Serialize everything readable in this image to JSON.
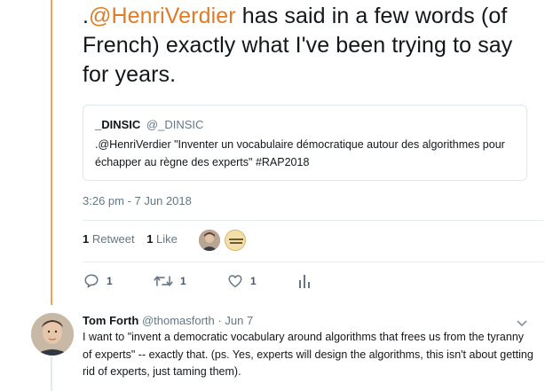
{
  "tweet": {
    "text_prefix": ".",
    "mention": "@HenriVerdier",
    "text_rest": " has said in a few words (of French) exactly what I've been trying to say for years.",
    "timestamp": "3:26 pm - 7 Jun 2018"
  },
  "quote": {
    "name": "_DINSIC",
    "handle": "@_DINSIC",
    "body": ".@HenriVerdier \"Inventer un vocabulaire démocratique autour des algorithmes pour échapper au règne des experts\" #RAP2018"
  },
  "stats": {
    "retweet_count": "1",
    "retweet_label": "Retweet",
    "like_count": "1",
    "like_label": "Like"
  },
  "actions": {
    "reply_count": "1",
    "retweet_count": "1",
    "like_count": "1"
  },
  "reply": {
    "name": "Tom Forth",
    "handle": "@thomasforth",
    "separator": "·",
    "date": "Jun 7",
    "text": "I want to \"invent a democratic vocabulary around algorithms that frees us from the tyranny of experts\" -- exactly that. (ps. Yes, experts will design the algorithms, this isn't about getting rid of experts, just taming them)."
  },
  "colors": {
    "accent": "#e07d24",
    "thread_line": "#f4a259",
    "secondary_text": "#657786",
    "border": "#e1e8ed"
  }
}
